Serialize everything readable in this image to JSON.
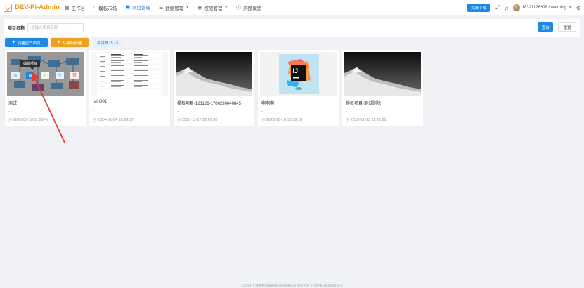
{
  "header": {
    "app_title": "DEV-Pi-Admin",
    "nav": [
      {
        "label": "工作台",
        "icon": "grid-icon",
        "glyph": "▦",
        "active": false,
        "dropdown": false
      },
      {
        "label": "模板市场",
        "icon": "store-icon",
        "glyph": "⌂",
        "active": false,
        "dropdown": false
      },
      {
        "label": "项目管理",
        "icon": "folder-icon",
        "glyph": "▣",
        "active": true,
        "dropdown": false
      },
      {
        "label": "数据管理",
        "icon": "database-icon",
        "glyph": "☰",
        "active": false,
        "dropdown": true
      },
      {
        "label": "权限管理",
        "icon": "user-icon",
        "glyph": "◉",
        "active": false,
        "dropdown": true
      },
      {
        "label": "问题反馈",
        "icon": "question-icon",
        "glyph": "ⓘ",
        "active": false,
        "dropdown": false
      }
    ],
    "download_label": "免费下载",
    "user": "18321126308 / weiming"
  },
  "search": {
    "label": "项目名称",
    "placeholder": "请输入项目名称",
    "value": "",
    "query_label": "查询",
    "reset_label": "重置"
  },
  "toolbar": {
    "create_blank_label": "创建空白项目",
    "create_template_label": "从模板创建",
    "count_label": "项目数: 5 / 5"
  },
  "cards": [
    {
      "title": "测试",
      "desc": "-",
      "time": "2023-09-18 11:56:47",
      "thumb": "diagram"
    },
    {
      "title": "rain001",
      "desc": "-",
      "time": "2024-01-04 18:29:17",
      "thumb": "document"
    },
    {
      "title": "模板项目-121121-1700230040845",
      "desc": "-",
      "time": "2023-11-17 22:07:30",
      "thumb": "mountain"
    },
    {
      "title": "啊啊啊",
      "desc": "-",
      "time": "2023-10-16 18:39:18",
      "thumb": "ij"
    },
    {
      "title": "模板项目-测试删除",
      "desc": "-",
      "time": "2023-12-13 11:21:21",
      "thumb": "mountain"
    }
  ],
  "overlay": {
    "tooltip": "编辑项目",
    "buttons": [
      {
        "name": "preview-icon",
        "glyph": "◎",
        "color": "#1e88e5",
        "bg": "#e6f1fc"
      },
      {
        "name": "edit-project-icon",
        "glyph": "⊞",
        "color": "#ffffff",
        "bg": "#1e88e5"
      },
      {
        "name": "check-icon",
        "glyph": "✓",
        "color": "#67c23a",
        "bg": "#f0f9eb"
      },
      {
        "name": "pencil-icon",
        "glyph": "✎",
        "color": "#1e88e5",
        "bg": "#e6f1fc"
      },
      {
        "name": "delete-icon",
        "glyph": "🗑",
        "color": "#f56c6c",
        "bg": "#fef0f0"
      }
    ]
  },
  "footer": "©2024 上海便利到家网络科技有限公司 版权所有 沪ICP备18038022号-8",
  "colors": {
    "primary": "#1e88e5",
    "accent": "#f0a020",
    "danger": "#e53935"
  }
}
